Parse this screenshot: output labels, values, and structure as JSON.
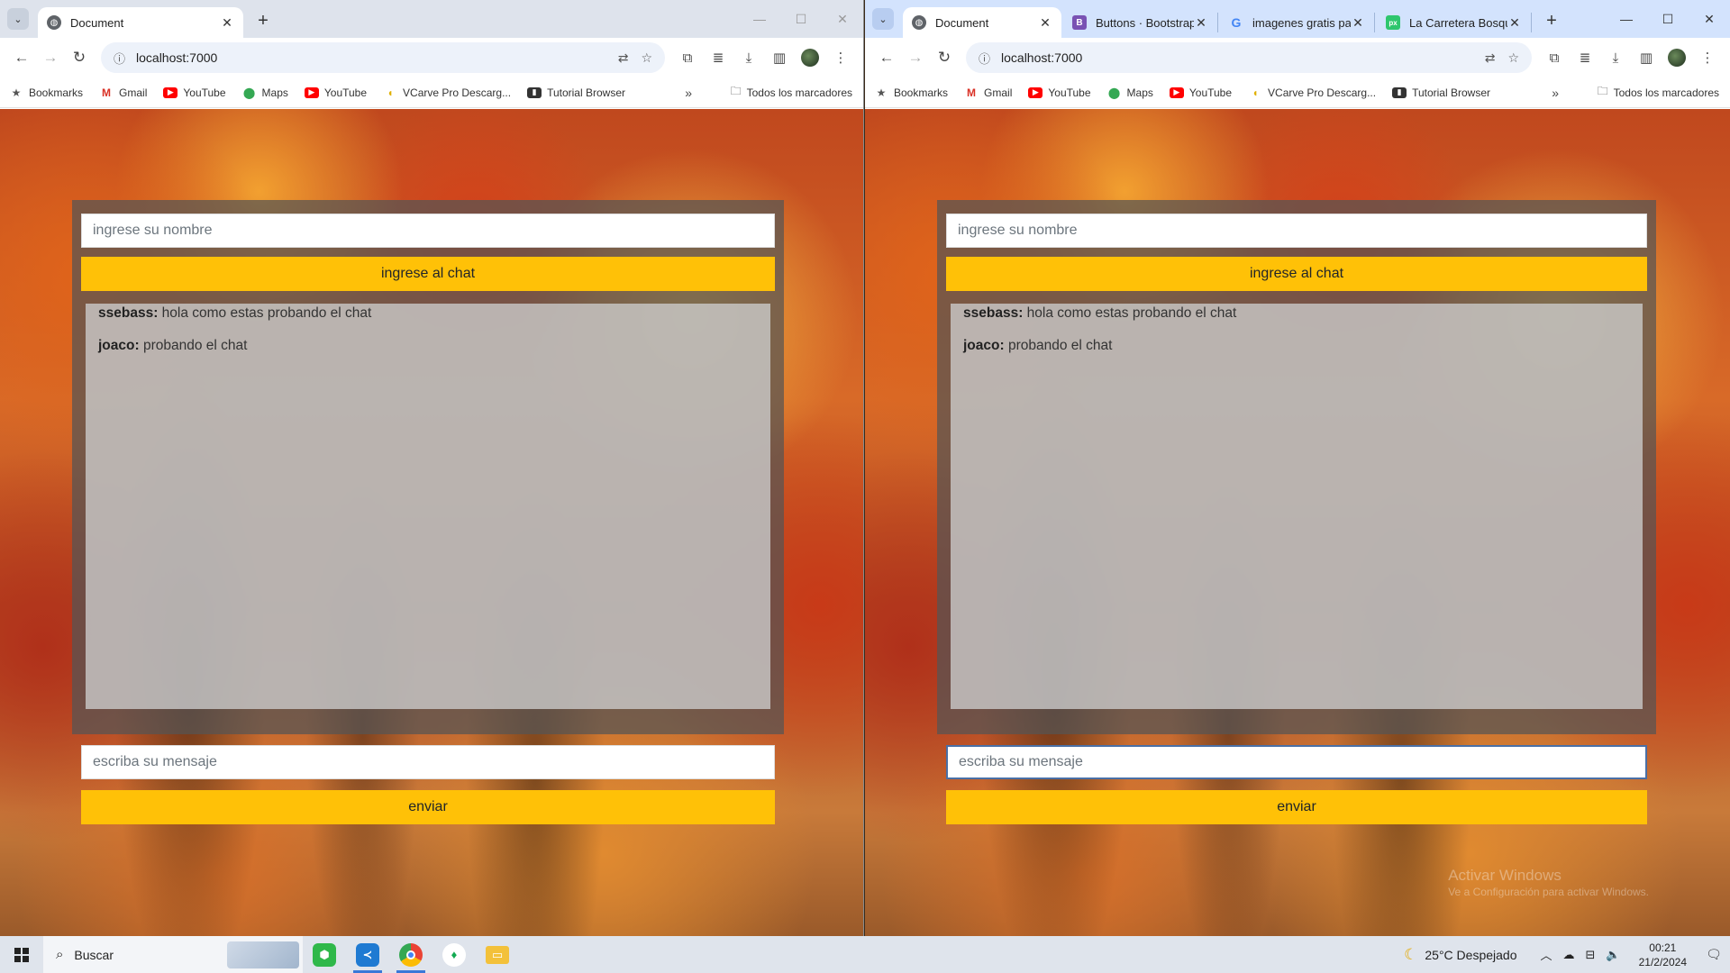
{
  "left_window": {
    "tab": {
      "title": "Document",
      "close": "✕"
    },
    "new_tab": "+",
    "controls": [
      "—",
      "☐",
      "✕"
    ],
    "address": "localhost:7000",
    "bookmarks": [
      "Bookmarks",
      "Gmail",
      "YouTube",
      "Maps",
      "YouTube",
      "VCarve Pro Descarg...",
      "Tutorial Browser"
    ],
    "bookmarks_more": "»",
    "all_bookmarks": "Todos los marcadores"
  },
  "right_window": {
    "tabs": [
      {
        "title": "Document",
        "icon": "globe-icon"
      },
      {
        "title": "Buttons · Bootstrap",
        "icon": "bootstrap-icon"
      },
      {
        "title": "imagenes gratis par",
        "icon": "google-icon"
      },
      {
        "title": "La Carretera Bosqu",
        "icon": "pixabay-icon"
      }
    ],
    "new_tab": "+",
    "controls": [
      "—",
      "☐",
      "✕"
    ],
    "address": "localhost:7000",
    "bookmarks": [
      "Bookmarks",
      "Gmail",
      "YouTube",
      "Maps",
      "YouTube",
      "VCarve Pro Descarg...",
      "Tutorial Browser"
    ],
    "bookmarks_more": "»",
    "all_bookmarks": "Todos los marcadores"
  },
  "chat": {
    "name_placeholder": "ingrese su nombre",
    "join_label": "ingrese al chat",
    "messages": [
      {
        "user": "ssebass:",
        "text": " hola como estas probando el chat"
      },
      {
        "user": "joaco:",
        "text": " probando el chat"
      }
    ],
    "message_placeholder": "escriba su mensaje",
    "send_label": "enviar"
  },
  "watermark": {
    "title": "Activar Windows",
    "subtitle": "Ve a Configuración para activar Windows."
  },
  "taskbar": {
    "search_label": "Buscar",
    "weather": "25°C  Despejado",
    "time": "00:21",
    "date": "21/2/2024"
  },
  "colors": {
    "accent_button": "#ffc107",
    "taskbar": "#dfe4ec",
    "active_tabstrip": "#d3e3fd"
  }
}
